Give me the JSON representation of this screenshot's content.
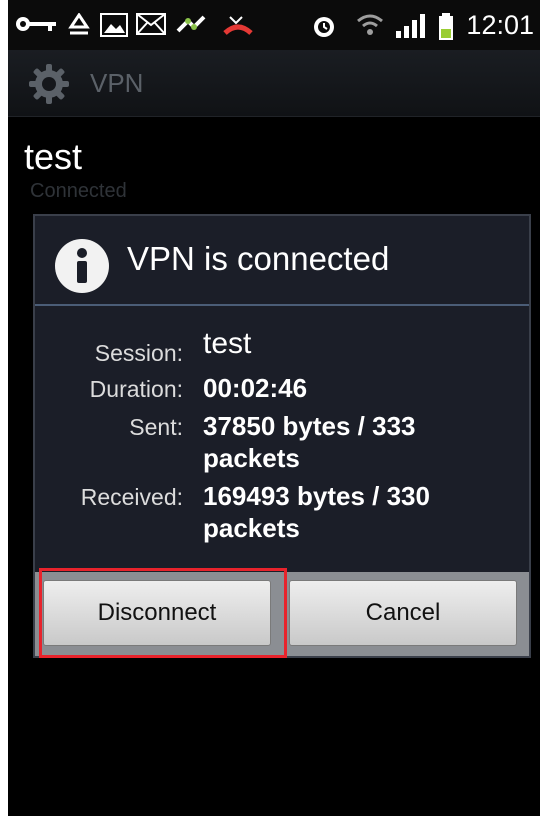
{
  "statusbar": {
    "time": "12:01",
    "icons": [
      "key-icon",
      "recycle-icon",
      "gallery-icon",
      "email-icon",
      "usb-debug-icon",
      "missed-call-icon",
      "alarm-icon",
      "wifi-icon",
      "signal-icon",
      "battery-icon"
    ]
  },
  "actionbar": {
    "title": "VPN",
    "icon": "gear-icon"
  },
  "vpn_entry": {
    "name": "test",
    "status": "Connected"
  },
  "dialog": {
    "title": "VPN is connected",
    "icon": "info-icon",
    "rows": [
      {
        "label": "Session:",
        "value": "test"
      },
      {
        "label": "Duration:",
        "value": "00:02:46"
      },
      {
        "label": "Sent:",
        "value": "37850 bytes / 333 packets"
      },
      {
        "label": "Received:",
        "value": "169493 bytes / 330 packets"
      }
    ],
    "buttons": {
      "disconnect": "Disconnect",
      "cancel": "Cancel"
    }
  },
  "colors": {
    "highlight": "#e8232c",
    "divider": "#4b5d77",
    "dialog_bg": "#1b1e28"
  }
}
